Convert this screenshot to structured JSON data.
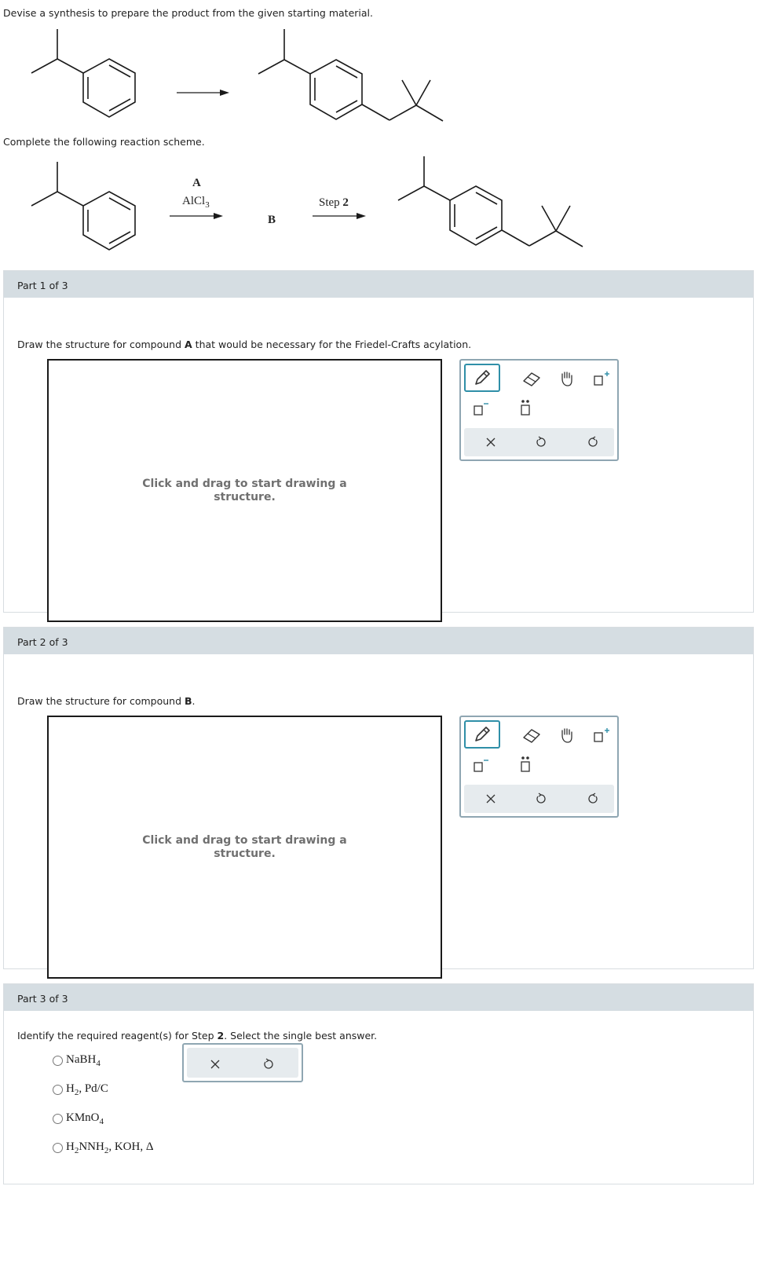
{
  "intro": {
    "prompt": "Devise a synthesis to prepare the product from the given starting material.",
    "scheme_prompt": "Complete the following reaction scheme."
  },
  "scheme": {
    "reagent_a": "A",
    "reagent_alcl3": "AlCl",
    "reagent_alcl3_sub": "3",
    "intermediate": "B",
    "step2_prefix": "Step ",
    "step2_num": "2"
  },
  "parts": [
    {
      "header": "Part 1 of 3",
      "question_pre": "Draw the structure for compound ",
      "question_bold": "A",
      "question_post": " that would be necessary for the Friedel-Crafts acylation.",
      "canvas_hint": "Click and drag to start drawing a structure."
    },
    {
      "header": "Part 2 of 3",
      "question_pre": "Draw the structure for compound ",
      "question_bold": "B",
      "question_post": ".",
      "canvas_hint": "Click and drag to start drawing a structure."
    },
    {
      "header": "Part 3 of 3",
      "question_pre": "Identify the required reagent(s) for Step ",
      "question_bold": "2",
      "question_post": ". Select the single best answer.",
      "choices": [
        {
          "main": "NaBH",
          "sub": "4",
          "rest": ""
        },
        {
          "main": "H",
          "sub": "2",
          "rest": ", Pd/C"
        },
        {
          "main": "KMnO",
          "sub": "4",
          "rest": ""
        },
        {
          "main": "H",
          "sub": "2",
          "rest": "NNH",
          "sub2": "2",
          "rest2": ", KOH, Δ"
        }
      ]
    }
  ],
  "toolbox": {
    "tools": [
      "pencil-icon",
      "eraser-icon",
      "hand-icon",
      "charge-plus-icon",
      "charge-minus-icon",
      "lone-pair-icon"
    ],
    "actions": [
      "clear-icon",
      "undo-icon",
      "redo-icon"
    ]
  },
  "colors": {
    "header_bg": "#d5dde2",
    "tool_accent": "#2f8fa8",
    "toolbox_border": "#8fa6b2",
    "toolbar_bg": "#e6ebee"
  }
}
